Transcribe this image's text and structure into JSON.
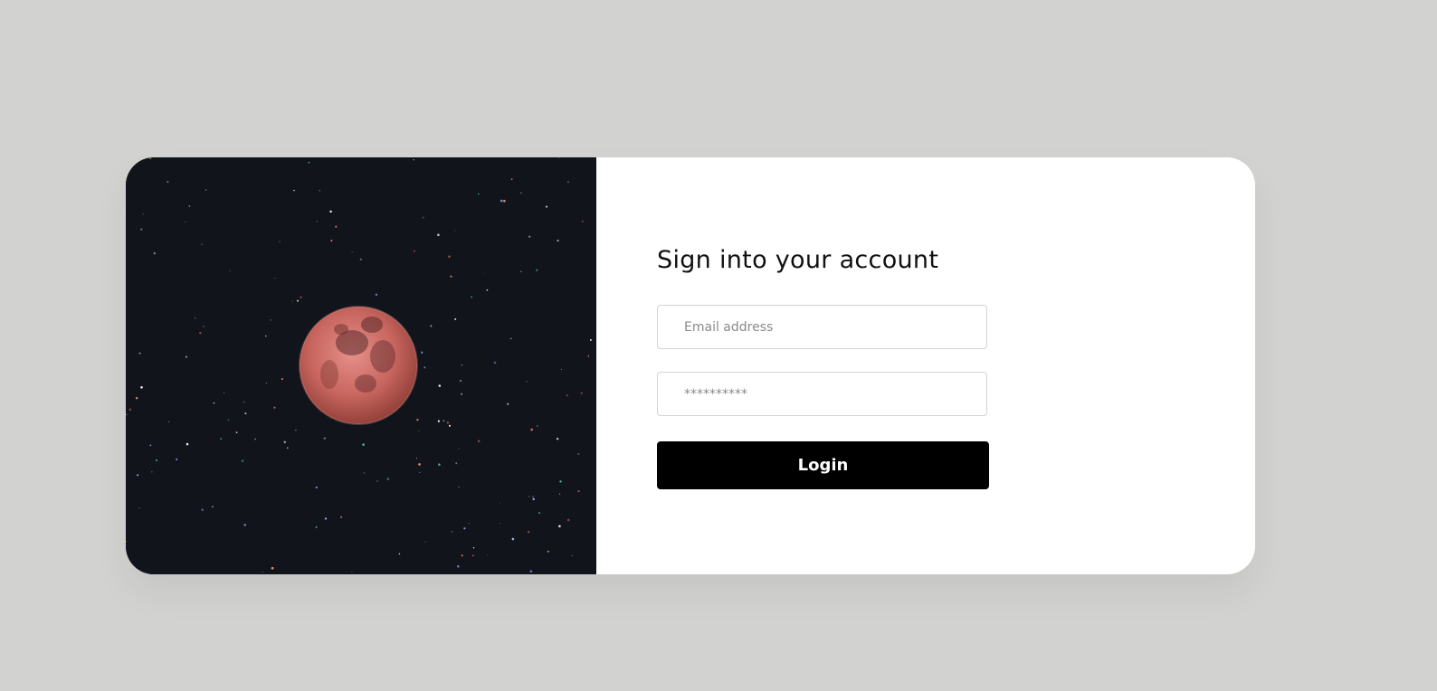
{
  "form": {
    "title": "Sign into your account",
    "email_placeholder": "Email address",
    "password_placeholder": "**********",
    "login_label": "Login"
  },
  "colors": {
    "page_background": "#d2d2d0",
    "card_background": "#ffffff",
    "image_background": "#11141a",
    "button_background": "#000000",
    "button_text": "#ffffff",
    "moon": "#c8655f"
  },
  "image": {
    "subject": "red moon in starry night sky"
  }
}
